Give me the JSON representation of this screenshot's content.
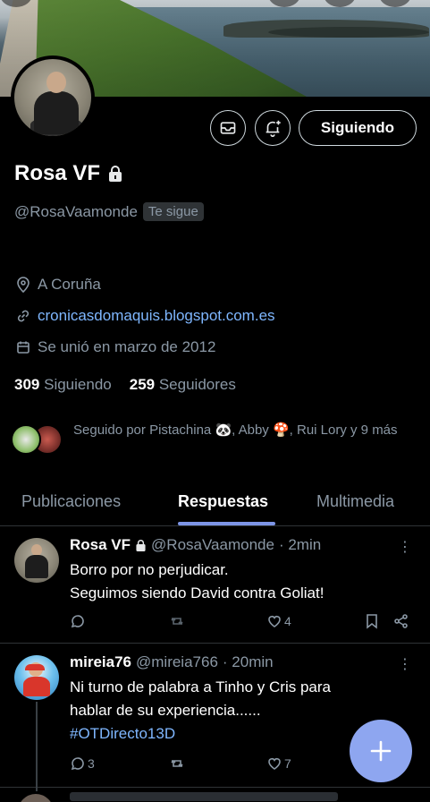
{
  "profile": {
    "name": "Rosa VF",
    "handle": "@RosaVaamonde",
    "follows_you_badge": "Te sigue",
    "location": "A Coruña",
    "website": "cronicasdomaquis.blogspot.com.es",
    "joined": "Se unió en marzo de 2012",
    "following_count": "309",
    "following_label": "Siguiendo",
    "followers_count": "259",
    "followers_label": "Seguidores",
    "followed_by_text": "Seguido por Pistachina 🐼, Abby 🍄, Rui Lory y 9 más",
    "lock_icon": "lock-icon"
  },
  "actions": {
    "follow_button_label": "Siguiendo",
    "message_icon": "envelope-icon",
    "notify_icon": "bell-plus-icon"
  },
  "tabs": [
    {
      "label": "Publicaciones"
    },
    {
      "label": "Respuestas"
    },
    {
      "label": "Multimedia"
    }
  ],
  "posts": [
    {
      "name": "Rosa VF",
      "handle": "@RosaVaamonde",
      "time": "· 2min",
      "lines": [
        "Borro por no perjudicar.",
        "Seguimos siendo David contra Goliat!"
      ],
      "likes": "4"
    },
    {
      "name": "mireia76",
      "handle": "@mireia766",
      "time": "· 20min",
      "lines": [
        "Ni turno de palabra a Tinho y Cris para",
        "hablar de su experiencia......"
      ],
      "hashtag": "#OTDirecto13D",
      "replies": "3",
      "likes": "7"
    }
  ],
  "colors": {
    "accent": "#8ea6f0",
    "link": "#7fb7ff",
    "muted": "#8b98a5",
    "tab_underline": "#7d95e6"
  }
}
